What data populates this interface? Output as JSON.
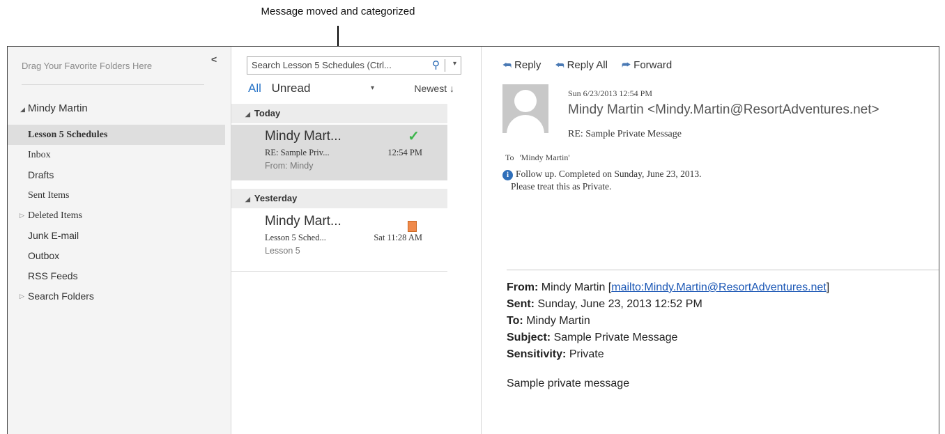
{
  "callout": {
    "text": "Message moved and categorized"
  },
  "folder_pane": {
    "favorites_placeholder": "Drag Your Favorite Folders Here",
    "collapse_glyph": "<",
    "account_name": "Mindy Martin",
    "folders": [
      {
        "label": "Lesson 5 Schedules",
        "selected": true
      },
      {
        "label": "Inbox"
      },
      {
        "label": "Drafts"
      },
      {
        "label": "Sent Items"
      },
      {
        "label": "Deleted Items",
        "expandable": true
      },
      {
        "label": "Junk E-mail"
      },
      {
        "label": "Outbox"
      },
      {
        "label": "RSS Feeds"
      },
      {
        "label": "Search Folders",
        "expandable": true
      }
    ]
  },
  "message_list": {
    "search_placeholder": "Search Lesson 5 Schedules (Ctrl...",
    "filter_all": "All",
    "filter_unread": "Unread",
    "sort_label": "Newest ↓",
    "groups": [
      {
        "label": "Today"
      },
      {
        "label": "Yesterday"
      }
    ],
    "messages": [
      {
        "sender": "Mindy Mart...",
        "subject": "RE: Sample Priv...",
        "time": "12:54 PM",
        "preview": "From: Mindy",
        "status": "check",
        "status_color": "#3bb54a"
      },
      {
        "sender": "Mindy Mart...",
        "subject": "Lesson 5 Sched...",
        "time": "Sat 11:28 AM",
        "preview": "Lesson 5",
        "status": "category",
        "status_color": "#f08a4b"
      }
    ]
  },
  "reading_pane": {
    "actions": {
      "reply": "Reply",
      "reply_all": "Reply All",
      "forward": "Forward"
    },
    "date": "Sun 6/23/2013 12:54 PM",
    "from": "Mindy Martin <Mindy.Martin@ResortAdventures.net>",
    "subject": "RE: Sample Private Message",
    "to_label": "To",
    "to_value": "'Mindy Martin'",
    "info_line1": "Follow up.  Completed on Sunday, June 23, 2013.",
    "info_line2": "Please treat this as Private.",
    "body": {
      "from_label": "From:",
      "from_value": "Mindy Martin [",
      "from_link": "mailto:Mindy.Martin@ResortAdventures.net",
      "from_close": "]",
      "sent_label": "Sent:",
      "sent_value": "Sunday, June 23, 2013 12:52 PM",
      "to_label": "To:",
      "to_value": "Mindy Martin",
      "subject_label": "Subject:",
      "subject_value": "Sample Private Message",
      "sensitivity_label": "Sensitivity:",
      "sensitivity_value": "Private",
      "text": "Sample private message"
    }
  },
  "colors": {
    "accent": "#2b76c8",
    "selection": "#dcdcdc",
    "link": "#1b57b5"
  }
}
